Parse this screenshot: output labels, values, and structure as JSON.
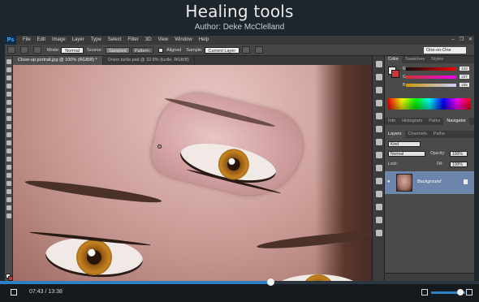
{
  "video": {
    "title": "Healing tools",
    "author": "Author: Deke McClelland",
    "time": "07:43 / 13:38",
    "progress": 0.565,
    "volume": 0.85
  },
  "app": {
    "logo": "Ps",
    "menu": [
      "File",
      "Edit",
      "Image",
      "Layer",
      "Type",
      "Select",
      "Filter",
      "3D",
      "View",
      "Window",
      "Help"
    ],
    "window_controls": [
      "–",
      "❐",
      "✕"
    ]
  },
  "options": {
    "mode_label": "Mode:",
    "mode_value": "Normal",
    "source_label": "Source:",
    "source_sampled": "Sampled",
    "source_pattern": "Pattern:",
    "aligned_label": "Aligned",
    "sample_label": "Sample:",
    "sample_value": "Current Layer",
    "workspace": "One-on-One"
  },
  "documents": [
    {
      "label": "Close-up portrait.jpg @ 100% (RGB/8) *",
      "active": true
    },
    {
      "label": "Onion turtle.psd @ 32.8% (turtle, RGB/8)",
      "active": false
    }
  ],
  "panels": {
    "color_tabs": [
      "Color",
      "Swatches",
      "Styles"
    ],
    "color_values": {
      "R": "243",
      "G": "237",
      "B": "235"
    },
    "info_tabs": [
      "Info",
      "Histogram",
      "Paths",
      "Navigator"
    ],
    "layers_tabs": [
      "Layers",
      "Channels",
      "Paths"
    ],
    "kind_label": "Kind",
    "blend_mode": "Normal",
    "opacity_label": "Opacity:",
    "opacity_value": "100%",
    "lock_label": "Lock:",
    "fill_label": "Fill:",
    "fill_value": "100%",
    "layer_name": "Background"
  },
  "colors": {
    "accent": "#2f7fc5",
    "layer_selected": "#6d84ab",
    "background_swatch": "#c83838"
  }
}
